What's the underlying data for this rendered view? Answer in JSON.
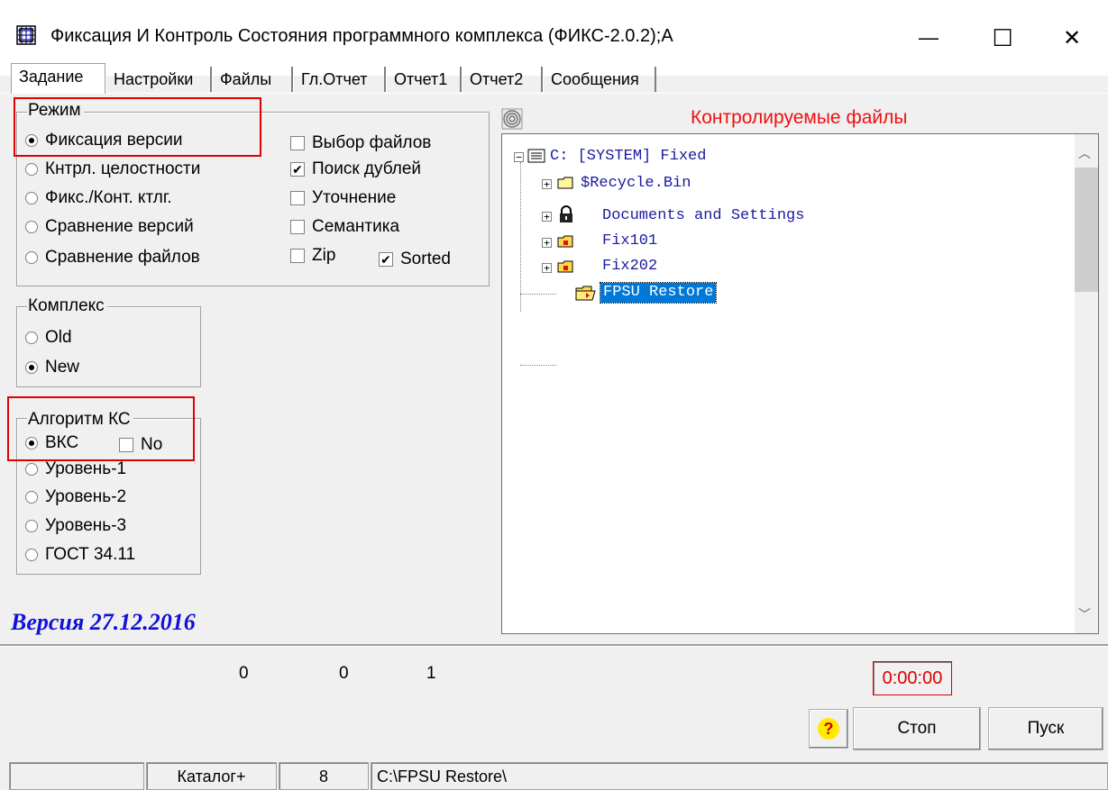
{
  "window": {
    "title": "Фиксация И Контроль Состояния программного комплекса (ФИКС-2.0.2);А",
    "minimize_glyph": "—",
    "maximize_glyph": "☐",
    "close_glyph": "✕"
  },
  "tabs": [
    {
      "label": "Задание",
      "active": true
    },
    {
      "label": "Настройки"
    },
    {
      "label": "Файлы"
    },
    {
      "label": "Гл.Отчет"
    },
    {
      "label": "Отчет1"
    },
    {
      "label": "Отчет2"
    },
    {
      "label": "Сообщения"
    }
  ],
  "mode_group": {
    "legend": "Режим",
    "radios": [
      {
        "label": "Фиксация версии",
        "checked": true
      },
      {
        "label": "Кнтрл. целостности",
        "checked": false
      },
      {
        "label": "Фикс./Конт. ктлг.",
        "checked": false
      },
      {
        "label": "Сравнение версий",
        "checked": false
      },
      {
        "label": "Сравнение файлов",
        "checked": false
      }
    ],
    "checks": [
      {
        "label": "Выбор файлов",
        "checked": false
      },
      {
        "label": "Поиск дублей",
        "checked": true
      },
      {
        "label": "Уточнение",
        "checked": false
      },
      {
        "label": "Семантика",
        "checked": false
      },
      {
        "label": "Zip",
        "checked": false
      }
    ],
    "sorted": {
      "label": "Sorted",
      "checked": true
    }
  },
  "complex_group": {
    "legend": "Комплекс",
    "radios": [
      {
        "label": "Old",
        "checked": false
      },
      {
        "label": "New",
        "checked": true
      }
    ]
  },
  "algo_group": {
    "legend": "Алгоритм КС",
    "radios": [
      {
        "label": "ВКС",
        "checked": true
      },
      {
        "label": "Уровень-1",
        "checked": false
      },
      {
        "label": "Уровень-2",
        "checked": false
      },
      {
        "label": "Уровень-3",
        "checked": false
      },
      {
        "label": "ГОСТ 34.11",
        "checked": false
      }
    ],
    "no_check": {
      "label": "No",
      "checked": false
    }
  },
  "version_label": "Версия 27.12.2016",
  "tree": {
    "header": "Контролируемые файлы",
    "root": "C:  [SYSTEM] Fixed",
    "items": [
      {
        "label": "$Recycle.Bin",
        "icon": "folder-icon"
      },
      {
        "label": "Documents and Settings",
        "icon": "lock-icon"
      },
      {
        "label": "Fix101",
        "icon": "folder-red-icon"
      },
      {
        "label": "Fix202",
        "icon": "folder-red-icon"
      },
      {
        "label": "FPSU Restore",
        "icon": "folder-open-icon",
        "selected": true
      }
    ]
  },
  "counters": [
    "0",
    "0",
    "1"
  ],
  "timer": "0:00:00",
  "buttons": {
    "help": "?",
    "stop": "Стоп",
    "start": "Пуск"
  },
  "statusbar": [
    "",
    "Каталог+",
    "8",
    "C:\\FPSU Restore\\"
  ],
  "colors": {
    "accent_red": "#e00000",
    "version_blue": "#1010d8",
    "tree_text": "#1a1aa0",
    "selection": "#0078d7"
  }
}
